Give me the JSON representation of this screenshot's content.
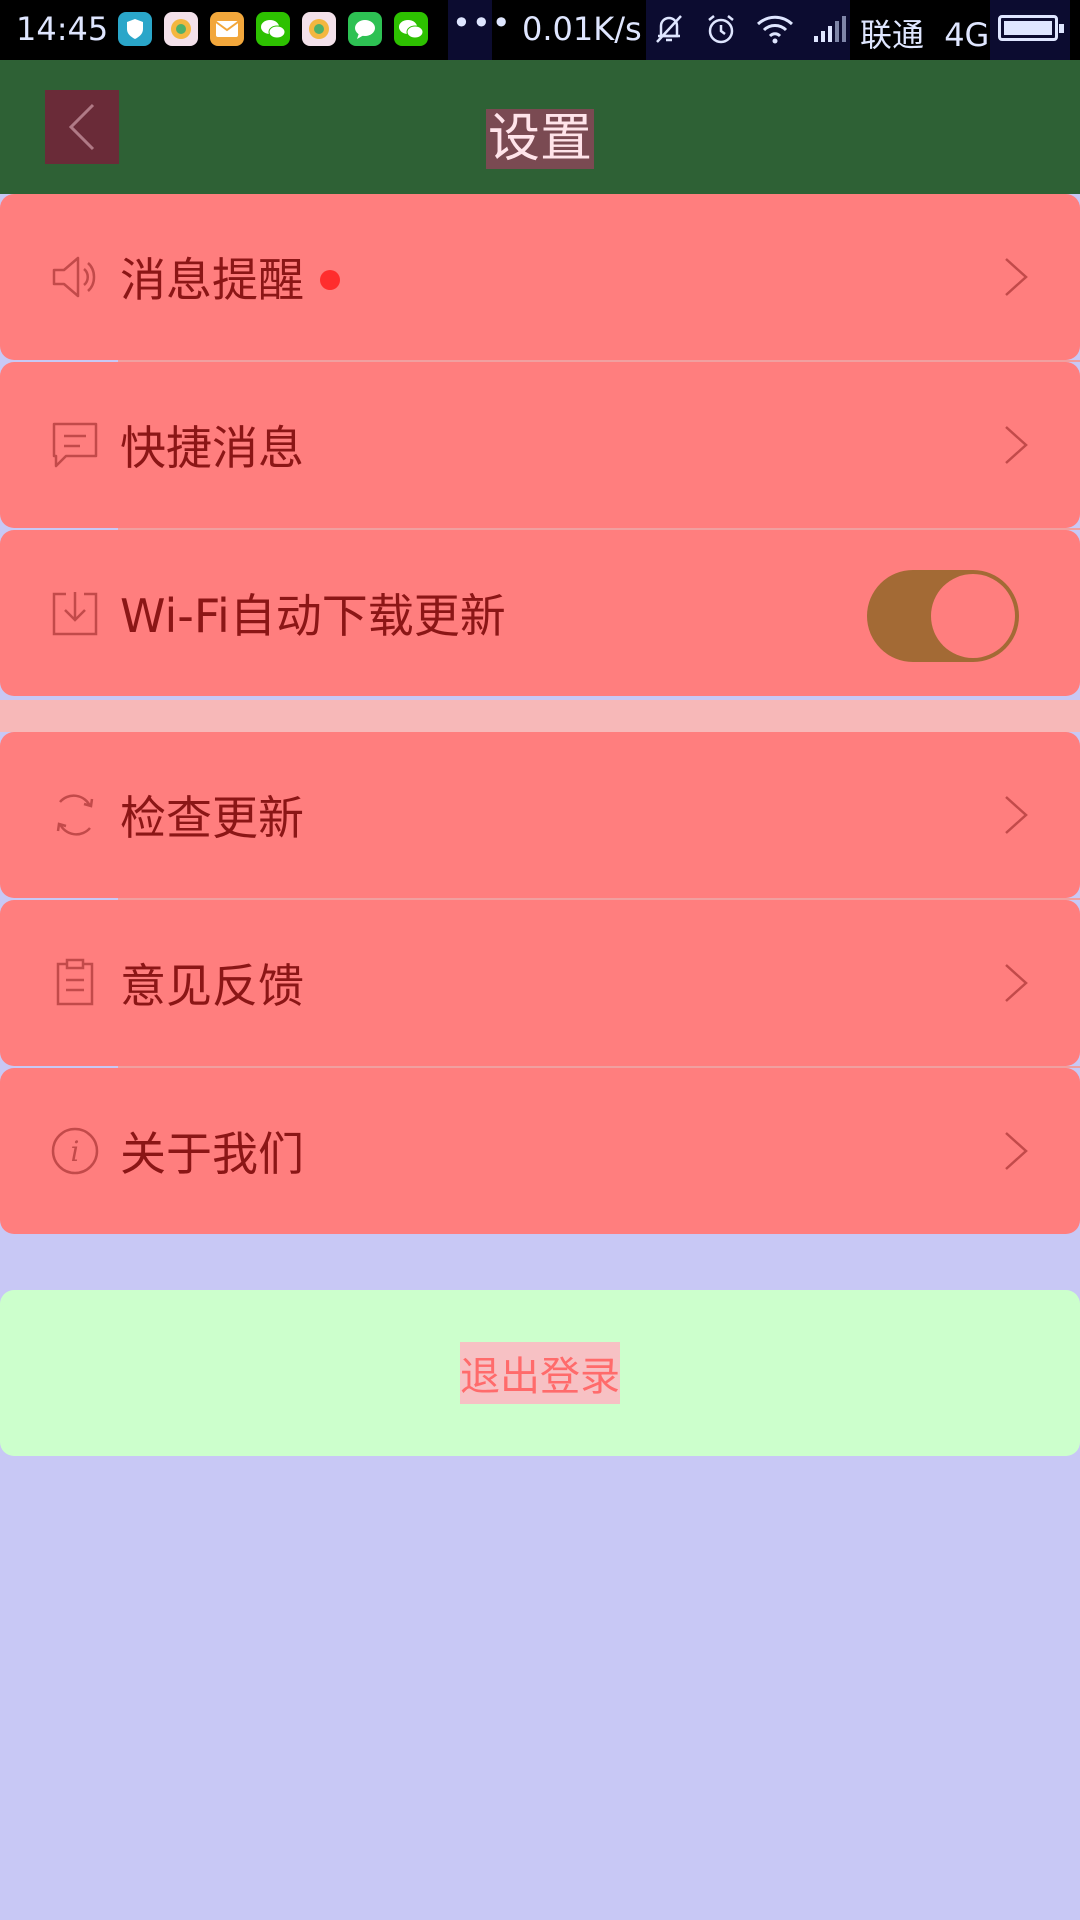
{
  "status_bar": {
    "time": "14:45",
    "more_indicator": "•••",
    "network_speed": "0.01K/s",
    "carrier": "联通",
    "network_type": "4G",
    "notification_icons": [
      "shield-app-icon",
      "photo-app-icon",
      "mail-app-icon",
      "wechat-icon",
      "photo-app-icon",
      "messages-icon",
      "wechat-icon"
    ],
    "system_icons": [
      "mute-icon",
      "alarm-icon",
      "wifi-icon",
      "signal-icon"
    ]
  },
  "header": {
    "title": "设置",
    "back_icon": "chevron-left-icon"
  },
  "settings": {
    "items": [
      {
        "label": "消息提醒",
        "icon": "speaker-icon",
        "has_badge": true,
        "badge_color": "#ff2d2d",
        "trailing": "chevron"
      },
      {
        "label": "快捷消息",
        "icon": "message-icon",
        "trailing": "chevron"
      },
      {
        "label": "Wi-Fi自动下载更新",
        "icon": "download-icon",
        "trailing": "toggle",
        "toggle_on": true
      },
      {
        "label": "检查更新",
        "icon": "refresh-icon",
        "trailing": "chevron"
      },
      {
        "label": "意见反馈",
        "icon": "feedback-icon",
        "trailing": "chevron"
      },
      {
        "label": "关于我们",
        "icon": "info-icon",
        "trailing": "chevron"
      }
    ]
  },
  "logout": {
    "label": "退出登录"
  },
  "colors": {
    "header_bg": "#2e6135",
    "row_bg": "#ff7e7e",
    "row_text": "#8b1616",
    "page_bg": "#c8c8f5",
    "logout_bg": "#ccffcc",
    "logout_text": "#ff6b6b",
    "toggle_track": "#a36a35"
  }
}
